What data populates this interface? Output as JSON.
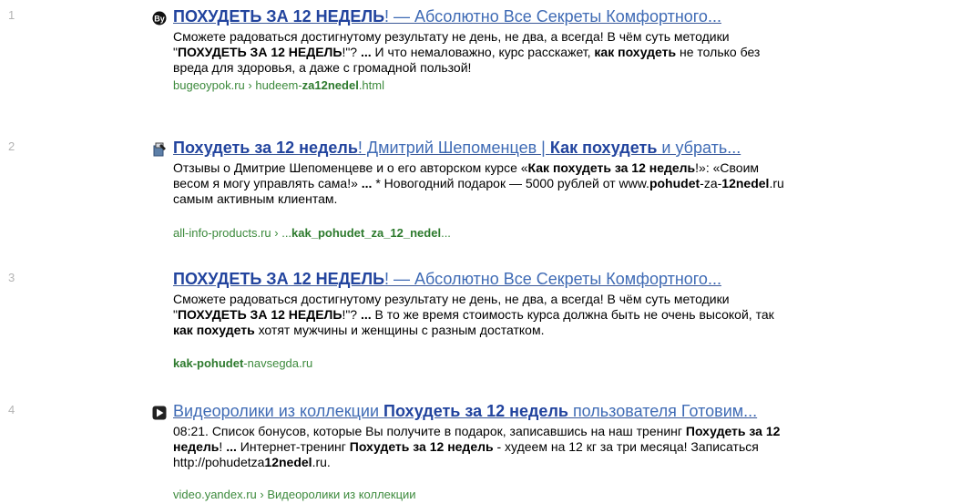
{
  "colors": {
    "link": "#3b5998",
    "url_green": "#3c8a3c",
    "number_gray": "#b4b4b4"
  },
  "results": [
    {
      "number": "1",
      "favicon": "by-icon",
      "title_hl": "ПОХУДЕТЬ ЗА 12 НЕДЕЛЬ",
      "title_rest": "! — Абсолютно Все Секреты Комфортного...",
      "snippet_parts": [
        "Сможете радоваться достигнутому результату не день, не два, а всегда! В чём суть методики \"",
        "ПОХУДЕТЬ ЗА 12 НЕДЕЛЬ",
        "!\"? ",
        "...",
        " И что немаловажно, курс расскажет, ",
        "как похудеть",
        " не только без вреда для здоровья, а даже с громадной пользой!"
      ],
      "url_parts": [
        "bugeoypok.ru › hudeem-",
        "za12nedel",
        ".html"
      ]
    },
    {
      "number": "2",
      "favicon": "pen-icon",
      "title_parts": [
        "Похудеть за 12 недель",
        "! Дмитрий Шепоменцев | ",
        "Как похудеть",
        " и убрать..."
      ],
      "snippet_parts": [
        "Отзывы о Дмитрие Шепоменцеве и о его авторском курсе «",
        "Как похудеть за 12 недель",
        "!»: «Своим весом я могу управлять сама!» ",
        "...",
        " * Новогодний подарок — 5000 рублей от www.",
        "pohudet",
        "-za-",
        "12nedel",
        ".ru самым активным клиентам."
      ],
      "url_parts": [
        "all-info-products.ru › ...",
        "kak_pohudet_za_12_nedel",
        "..."
      ]
    },
    {
      "number": "3",
      "title_hl": "ПОХУДЕТЬ ЗА 12 НЕДЕЛЬ",
      "title_rest": "! — Абсолютно Все Секреты Комфортного...",
      "snippet_parts": [
        "Сможете радоваться достигнутому результату не день, не два, а всегда! В чём суть методики \"",
        "ПОХУДЕТЬ ЗА 12 НЕДЕЛЬ",
        "!\"? ",
        "...",
        " В то же время стоимость курса должна быть не очень высокой, так ",
        "как похудеть",
        " хотят мужчины и женщины с разным достатком."
      ],
      "url_parts": [
        "kak-pohudet",
        "-navsegda.ru"
      ]
    },
    {
      "number": "4",
      "favicon": "play-icon",
      "title_parts": [
        "Видеоролики из коллекции ",
        "Похудеть за 12 недель",
        " пользователя Готовим..."
      ],
      "snippet_parts": [
        "08:21. Список бонусов, которые Вы получите в подарок, записавшись на наш тренинг ",
        "Похудеть за 12 недель",
        "! ",
        "...",
        " Интернет-тренинг ",
        "Похудеть за 12 недель",
        " - худеем на 12 кг за три месяца! Записаться http://pohudetza",
        "12nedel",
        ".ru."
      ],
      "url": "video.yandex.ru › Видеоролики из коллекции"
    }
  ]
}
